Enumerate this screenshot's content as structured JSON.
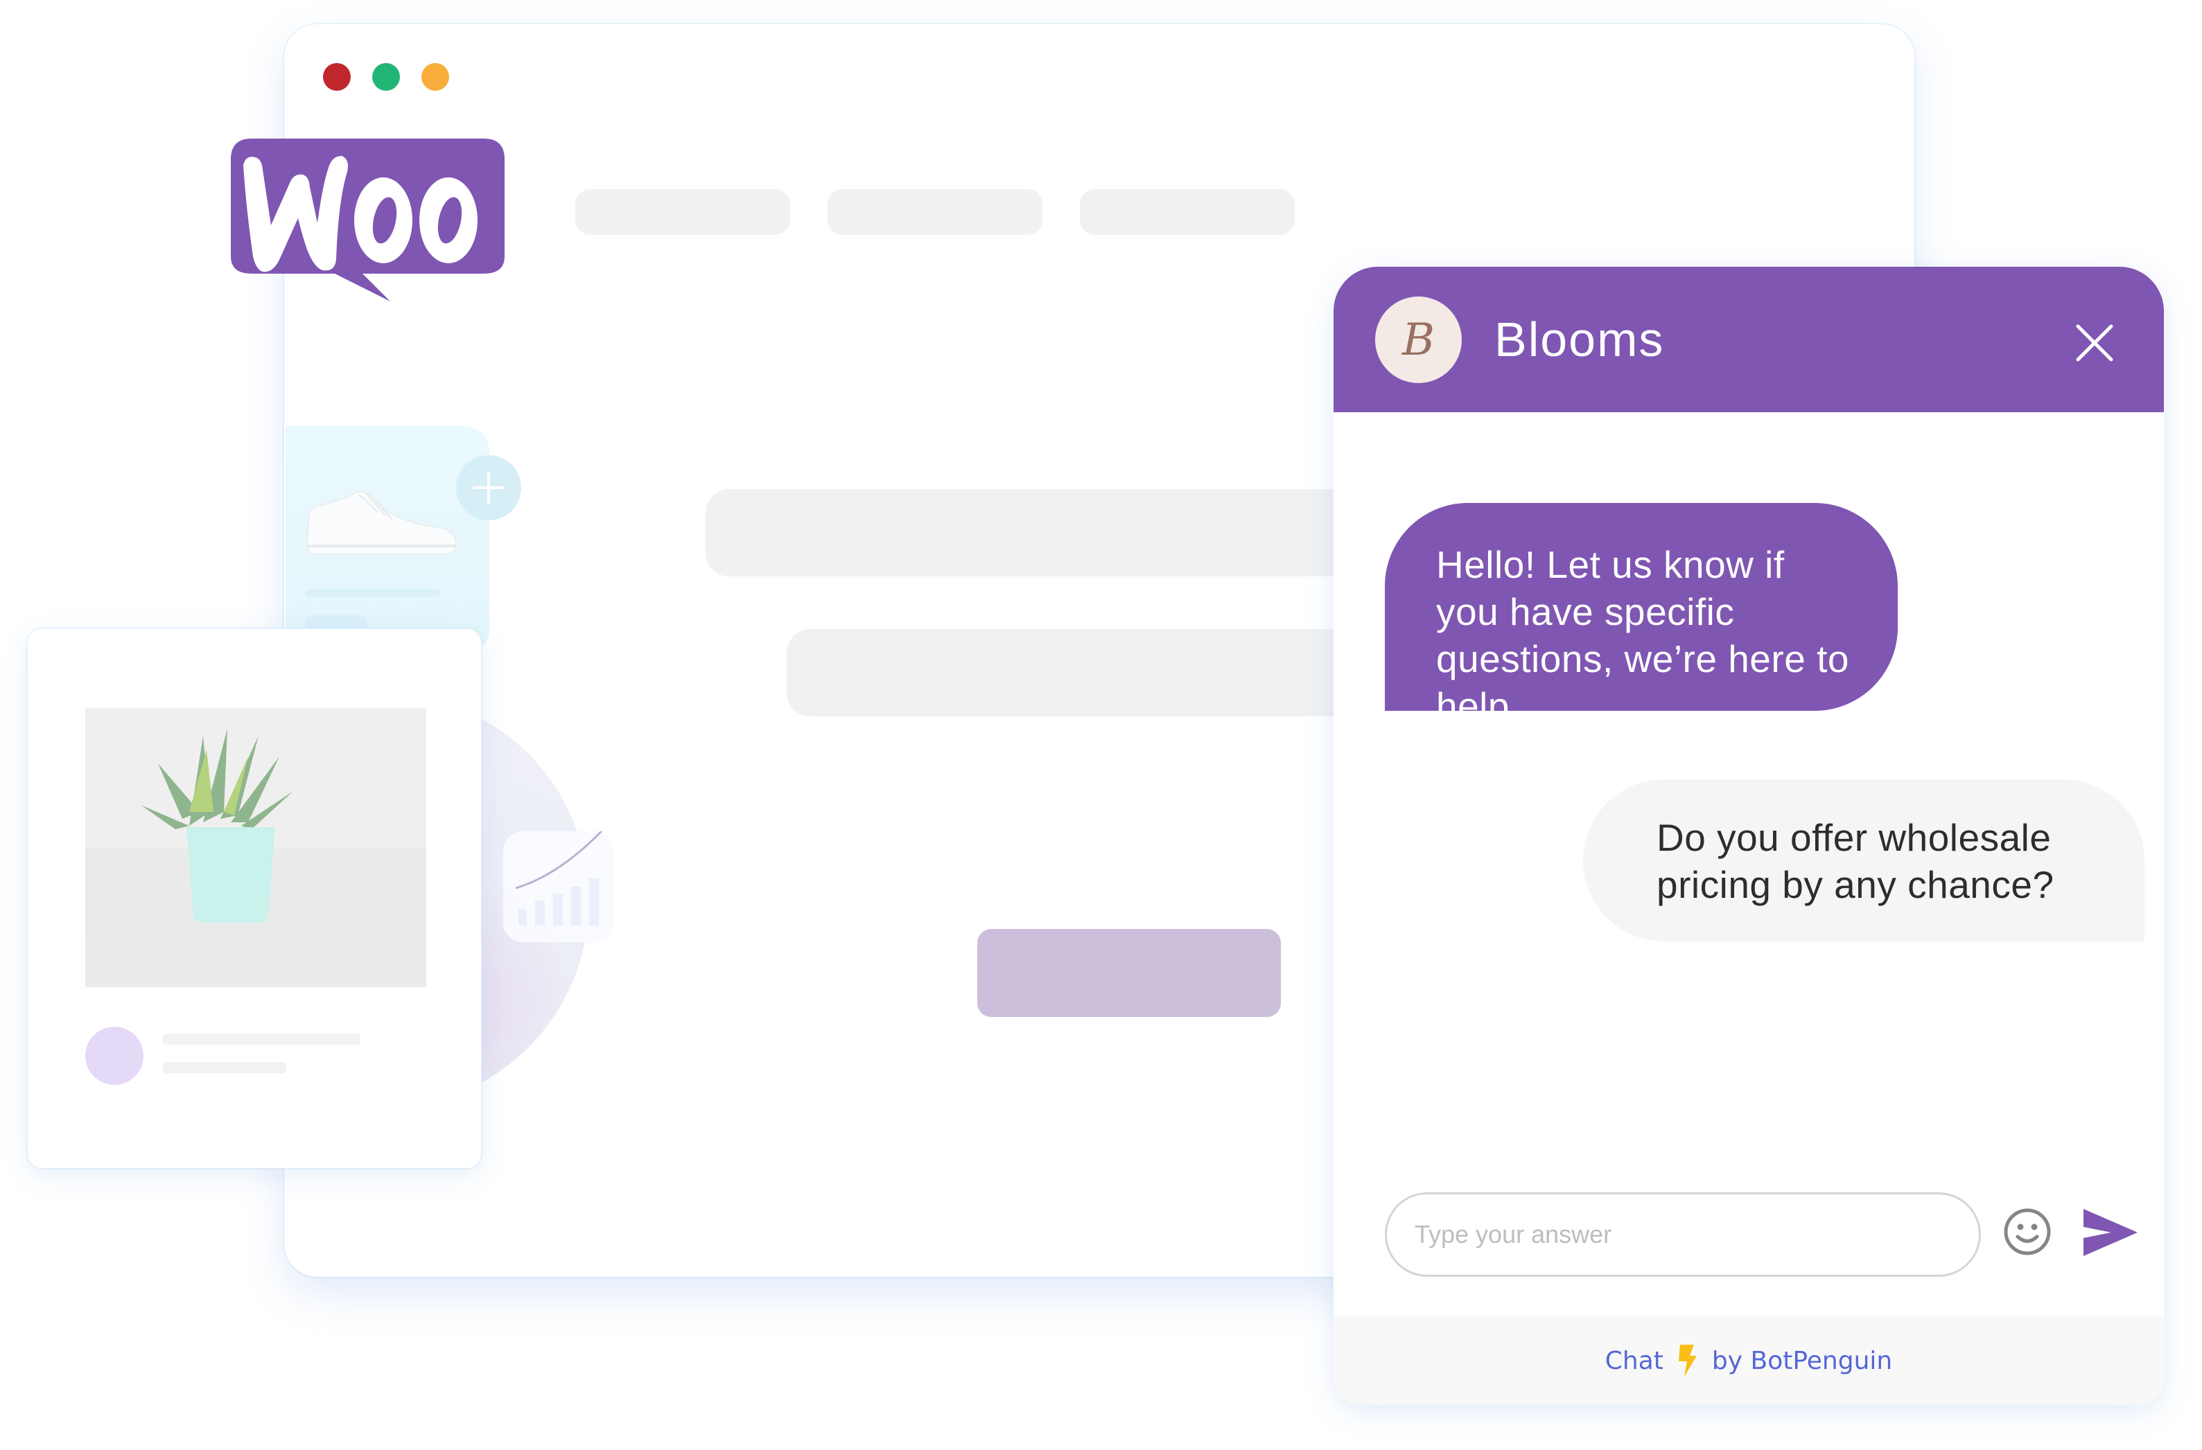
{
  "browser": {
    "window_controls": [
      {
        "name": "close",
        "color": "#C0272D"
      },
      {
        "name": "minimize",
        "color": "#23B575"
      },
      {
        "name": "maximize",
        "color": "#F8AD3C"
      }
    ],
    "logo": {
      "text": "Woo",
      "color": "#7F56B2"
    },
    "nav_placeholders": 3,
    "cta_color": "#CBBFDB"
  },
  "product_cards": {
    "shoe_card": {
      "image": "white sneaker",
      "action_icon": "plus-icon"
    },
    "plant_card": {
      "image": "succulent in mint pot"
    },
    "chart_badge": {
      "icon": "growth-chart-icon"
    }
  },
  "chat": {
    "brand_color": "#7F56B2",
    "header": {
      "avatar_letter": "B",
      "title": "Blooms",
      "close_icon": "close-icon"
    },
    "messages": [
      {
        "sender": "bot",
        "text": "Hello! Let us know if you have specific questions, we’re here to help."
      },
      {
        "sender": "user",
        "text": "Do you offer wholesale pricing by any chance?"
      }
    ],
    "input": {
      "value": "",
      "placeholder": "Type your answer"
    },
    "emoji_icon": "smiley-icon",
    "send_icon": "send-icon",
    "footer": {
      "prefix": "Chat",
      "icon": "lightning-bolt-icon",
      "suffix": "by BotPenguin"
    }
  }
}
